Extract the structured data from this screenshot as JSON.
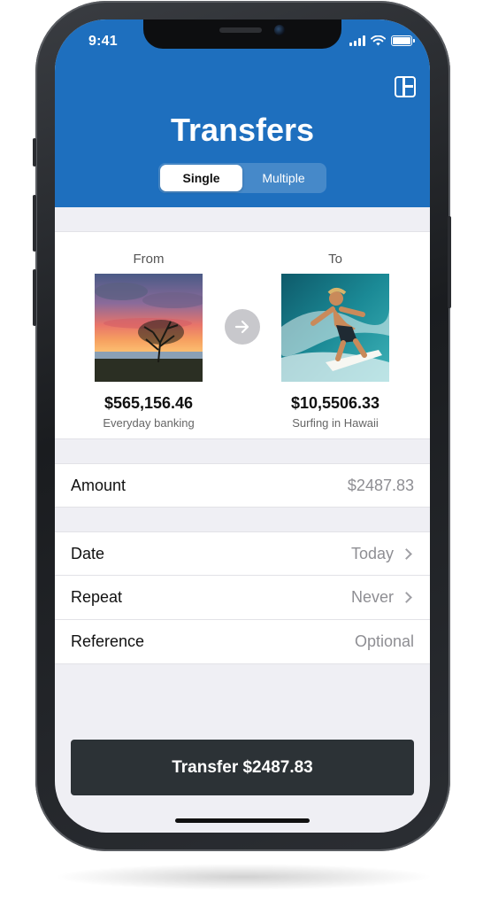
{
  "status_bar": {
    "time": "9:41"
  },
  "header": {
    "title": "Transfers",
    "segments": [
      {
        "label": "Single",
        "active": true
      },
      {
        "label": "Multiple",
        "active": false
      }
    ],
    "background_color": "#1e6fbe"
  },
  "from_account": {
    "label": "From",
    "balance": "$565,156.46",
    "name": "Everyday banking",
    "image_icon": "sunset-tree-photo"
  },
  "to_account": {
    "label": "To",
    "balance": "$10,5506.33",
    "name": "Surfing in Hawaii",
    "image_icon": "surfer-photo"
  },
  "form": {
    "amount": {
      "label": "Amount",
      "value": "$2487.83"
    },
    "date": {
      "label": "Date",
      "value": "Today"
    },
    "repeat": {
      "label": "Repeat",
      "value": "Never"
    },
    "reference": {
      "label": "Reference",
      "placeholder": "Optional"
    }
  },
  "transfer_button": {
    "label": "Transfer $2487.83",
    "color": "#2c3236"
  }
}
